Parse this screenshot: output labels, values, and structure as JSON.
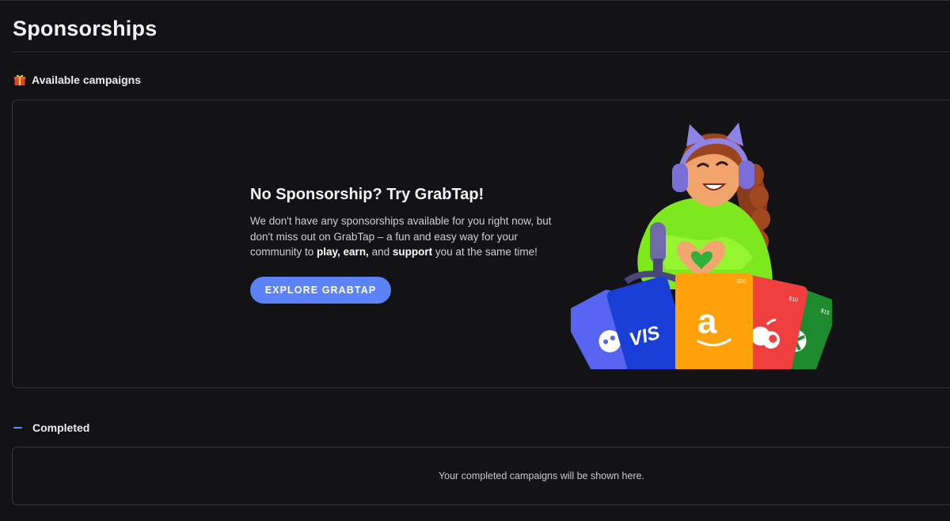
{
  "page": {
    "title": "Sponsorships"
  },
  "available": {
    "section_title": "Available campaigns",
    "icon": "gift-icon"
  },
  "promo": {
    "heading": "No Sponsorship? Try GrabTap!",
    "body_intro": "We don't have any sponsorships available for you right now, but don't miss out on GrabTap – a fun and easy way for your community to ",
    "body_play": "play, earn,",
    "body_and": " and ",
    "body_support": "support",
    "body_end": " you at the same time!",
    "button_label": "EXPLORE GRABTAP"
  },
  "illustration": {
    "cards": [
      {
        "brand": "discord",
        "color": "#5865f2"
      },
      {
        "brand": "visa",
        "color": "#1a3fd6",
        "text": "VIS"
      },
      {
        "brand": "amazon",
        "color": "#ffa10a",
        "value": "$20"
      },
      {
        "brand": "apple",
        "color": "#ee3e3e",
        "value": "$10"
      },
      {
        "brand": "xbox",
        "color": "#1e8a2e",
        "value": "$15"
      }
    ]
  },
  "completed": {
    "section_title": "Completed",
    "empty_message": "Your completed campaigns will be shown here."
  },
  "colors": {
    "background": "#131316",
    "accent": "#5b82f6",
    "border": "#34343b"
  }
}
